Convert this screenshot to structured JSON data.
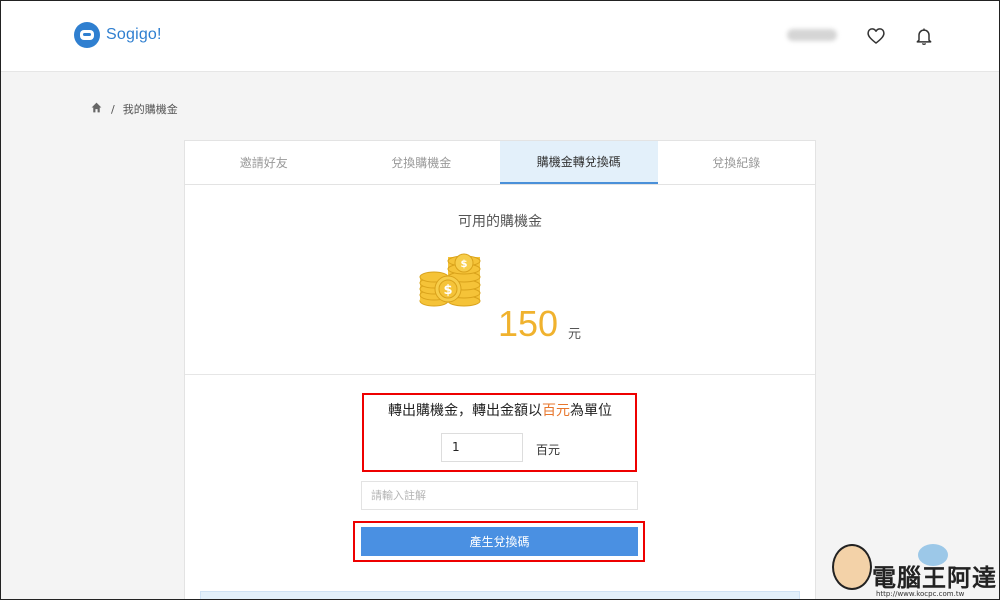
{
  "header": {
    "logo_text": "Sogigo!",
    "favorites_icon": "heart-icon",
    "notifications_icon": "bell-icon"
  },
  "breadcrumb": {
    "home_icon": "home-icon",
    "separator": "/",
    "current": "我的購機金"
  },
  "tabs": [
    {
      "label": "邀請好友",
      "active": false
    },
    {
      "label": "兌換購機金",
      "active": false
    },
    {
      "label": "購機金轉兌換碼",
      "active": true
    },
    {
      "label": "兌換紀錄",
      "active": false
    }
  ],
  "balance": {
    "title": "可用的購機金",
    "amount": "150",
    "unit": "元",
    "icon": "coins-icon"
  },
  "transfer": {
    "label_prefix": "轉出購機金，轉出金額以",
    "label_highlight": "百元",
    "label_suffix": "為單位",
    "amount_value": "1",
    "amount_unit": "百元",
    "note_placeholder": "請輸入註解",
    "generate_button": "產生兌換碼"
  },
  "watermark": {
    "text": "電腦王阿達",
    "url": "http://www.kocpc.com.tw"
  },
  "colors": {
    "accent_blue": "#4a90e2",
    "active_tab_bg": "#e3f0fa",
    "coin_gold": "#f0b22e",
    "highlight_orange": "#e7762c",
    "annotation_red": "#e00000"
  }
}
